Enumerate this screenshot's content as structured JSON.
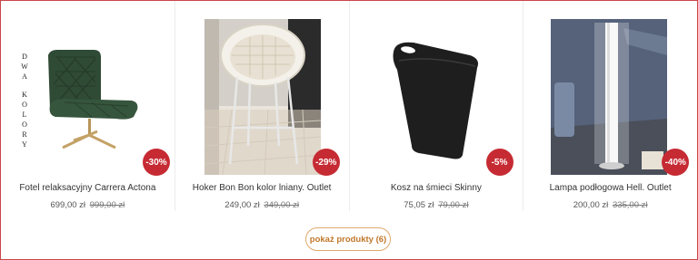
{
  "products": [
    {
      "title": "Fotel relaksacyjny Carrera Actona",
      "price": "699,00 zł",
      "old_price": "999,00 zł",
      "discount": "-30%",
      "side_text": [
        "D",
        "W",
        "A",
        "K",
        "O",
        "L",
        "O",
        "R",
        "Y"
      ]
    },
    {
      "title": "Hoker Bon Bon kolor lniany. Outlet",
      "price": "249,00 zł",
      "old_price": "349,00 zł",
      "discount": "-29%"
    },
    {
      "title": "Kosz na śmieci Skinny",
      "price": "75,05 zł",
      "old_price": "79,00 zł",
      "discount": "-5%"
    },
    {
      "title": "Lampa podłogowa Hell. Outlet",
      "price": "200,00 zł",
      "old_price": "335,00 zł",
      "discount": "-40%"
    }
  ],
  "show_more_label": "pokaż produkty (6)",
  "colors": {
    "frame_border": "#c9474a",
    "badge": "#c62b33",
    "button_accent": "#c0772a"
  }
}
